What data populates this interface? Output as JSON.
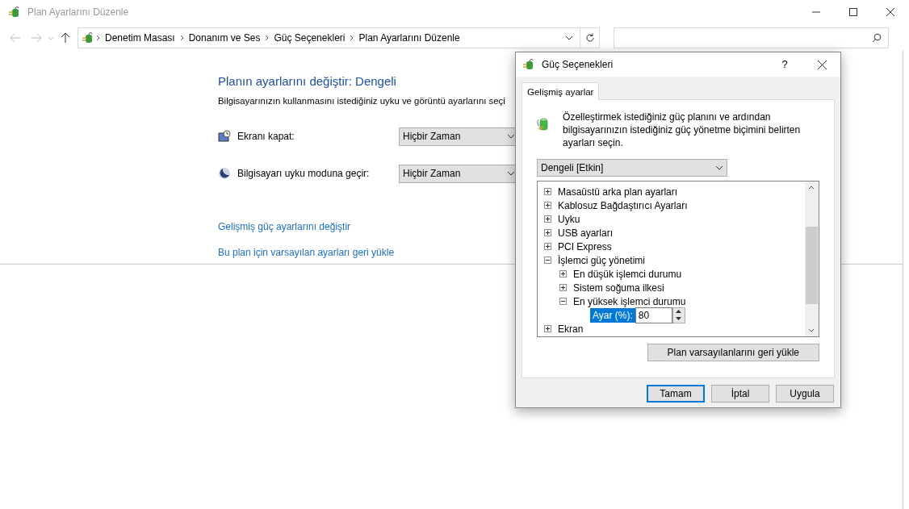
{
  "window": {
    "title": "Plan Ayarlarını Düzenle"
  },
  "address_bar": {
    "breadcrumbs": [
      "Denetim Masası",
      "Donanım ve Ses",
      "Güç Seçenekleri",
      "Plan Ayarlarını Düzenle"
    ]
  },
  "page": {
    "heading": "Planın ayarlarını değiştir: Dengeli",
    "description": "Bilgisayarınızın kullanmasını istediğiniz uyku ve görüntü ayarlarını seçi",
    "settings": [
      {
        "kind": "display",
        "label": "Ekranı kapat:",
        "value": "Hiçbir Zaman"
      },
      {
        "kind": "sleep",
        "label": "Bilgisayarı uyku moduna geçir:",
        "value": "Hiçbir Zaman"
      }
    ],
    "links": [
      "Gelişmiş güç ayarlarını değiştir",
      "Bu plan için varsayılan ayarları geri yükle"
    ]
  },
  "dialog": {
    "title": "Güç Seçenekleri",
    "help": "?",
    "tabs": [
      {
        "label": "Gelişmiş ayarlar",
        "selected": true
      }
    ],
    "intro": "Özelleştirmek istediğiniz güç planını ve ardından bilgisayarınızın istediğiniz güç yönetme biçimini belirten ayarları seçin.",
    "plan": "Dengeli [Etkin]",
    "tree": [
      {
        "label": "Masaüstü arka plan ayarları",
        "expanded": false
      },
      {
        "label": "Kablosuz Bağdaştırıcı Ayarları",
        "expanded": false
      },
      {
        "label": "Uyku",
        "expanded": false
      },
      {
        "label": "USB ayarları",
        "expanded": false
      },
      {
        "label": "PCI Express",
        "expanded": false
      },
      {
        "label": "İşlemci güç yönetimi",
        "expanded": true,
        "children": [
          {
            "label": "En düşük işlemci durumu",
            "expanded": false
          },
          {
            "label": "Sistem soğuma ilkesi",
            "expanded": false
          },
          {
            "label": "En yüksek işlemci durumu",
            "expanded": true,
            "setting": {
              "label": "Ayar (%):",
              "value": "80",
              "selected": true
            }
          }
        ]
      },
      {
        "label": "Ekran",
        "expanded": false
      }
    ],
    "restore_button": "Plan varsayılanlarını geri yükle",
    "buttons": [
      {
        "label": "Tamam",
        "default": true
      },
      {
        "label": "İptal",
        "default": false
      },
      {
        "label": "Uygula",
        "default": false
      }
    ]
  }
}
